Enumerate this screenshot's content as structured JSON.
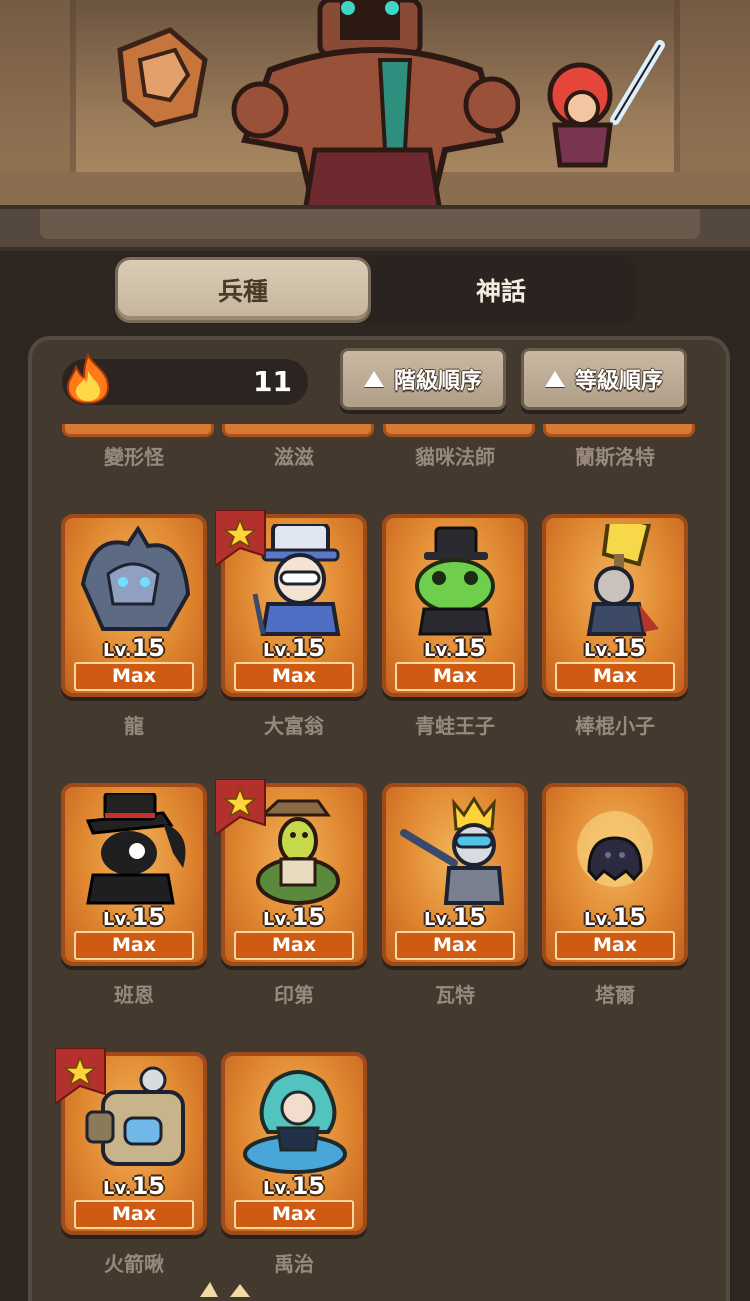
{
  "tabs": [
    {
      "label": "兵種",
      "active": true
    },
    {
      "label": "神話",
      "active": false
    }
  ],
  "counter": {
    "icon": "flame-icon",
    "value": "11"
  },
  "sort_buttons": [
    {
      "label": "階級順序",
      "icon": "triangle-up-icon"
    },
    {
      "label": "等級順序",
      "icon": "triangle-up-icon"
    }
  ],
  "previous_row_names": [
    "變形怪",
    "滋滋",
    "貓咪法師",
    "蘭斯洛特"
  ],
  "level_prefix": "Lv.",
  "units": [
    {
      "name": "龍",
      "level": "15",
      "status": "Max",
      "starred": false
    },
    {
      "name": "大富翁",
      "level": "15",
      "status": "Max",
      "starred": true
    },
    {
      "name": "青蛙王子",
      "level": "15",
      "status": "Max",
      "starred": false
    },
    {
      "name": "棒棍小子",
      "level": "15",
      "status": "Max",
      "starred": false
    },
    {
      "name": "班恩",
      "level": "15",
      "status": "Max",
      "starred": false
    },
    {
      "name": "印第",
      "level": "15",
      "status": "Max",
      "starred": true
    },
    {
      "name": "瓦特",
      "level": "15",
      "status": "Max",
      "starred": false
    },
    {
      "name": "塔爾",
      "level": "15",
      "status": "Max",
      "starred": false
    },
    {
      "name": "火箭啾",
      "level": "15",
      "status": "Max",
      "starred": true
    },
    {
      "name": "禹治",
      "level": "15",
      "status": "Max",
      "starred": false
    }
  ],
  "colors": {
    "card_orange": "#df8630",
    "card_border": "#9e4a19",
    "max_bar": "#cf5a14",
    "star_badge": "#b3302c",
    "panel_bg": "#43392f"
  }
}
